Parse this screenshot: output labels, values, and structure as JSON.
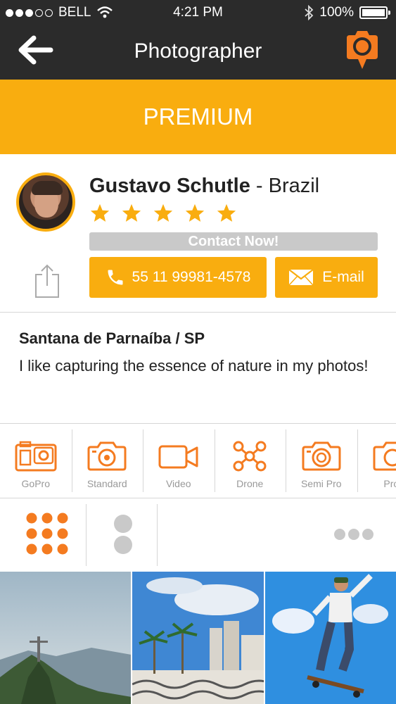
{
  "status_bar": {
    "carrier": "BELL",
    "time": "4:21 PM",
    "battery": "100%",
    "signal_bars_filled": 3,
    "signal_bars_total": 5
  },
  "nav": {
    "title": "Photographer",
    "back_icon": "arrow-left-icon",
    "action_icon": "camera-pin-icon"
  },
  "banner": {
    "label": "PREMIUM"
  },
  "profile": {
    "name": "Gustavo Schutle",
    "country": " - Brazil",
    "rating": 5,
    "rating_max": 5,
    "contact_label": "Contact Now!",
    "phone": "55 11 99981-4578",
    "email_label": "E-mail",
    "location": "Santana de Parnaíba / SP",
    "bio": "I like capturing the essence of nature in my photos!"
  },
  "equipment": [
    {
      "label": "GoPro",
      "icon": "gopro-icon"
    },
    {
      "label": "Standard",
      "icon": "camera-icon"
    },
    {
      "label": "Video",
      "icon": "video-camera-icon"
    },
    {
      "label": "Drone",
      "icon": "drone-icon"
    },
    {
      "label": "Semi Pro",
      "icon": "semi-pro-camera-icon"
    },
    {
      "label": "Prof",
      "icon": "pro-camera-icon"
    }
  ],
  "colors": {
    "accent": "#f9ad0f",
    "icon_orange": "#f47b20",
    "dark_bar": "#2b2b2b",
    "muted": "#c9c9c9"
  }
}
